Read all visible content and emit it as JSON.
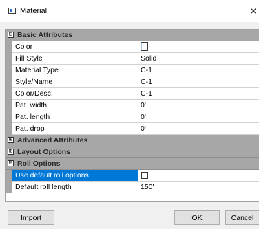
{
  "window": {
    "title": "Material",
    "close_glyph": "✕"
  },
  "grid": {
    "categories": [
      {
        "label": "Basic Attributes",
        "expanded": true,
        "expander": "⊟",
        "properties": [
          {
            "name": "Color",
            "value": "",
            "kind": "color-swatch"
          },
          {
            "name": "Fill Style",
            "value": "Solid"
          },
          {
            "name": "Material Type",
            "value": "C-1"
          },
          {
            "name": "Style/Name",
            "value": "C-1"
          },
          {
            "name": "Color/Desc.",
            "value": "C-1"
          },
          {
            "name": "Pat. width",
            "value": "0'"
          },
          {
            "name": "Pat. length",
            "value": "0'"
          },
          {
            "name": "Pat. drop",
            "value": "0'"
          }
        ]
      },
      {
        "label": "Advanced Attributes",
        "expanded": false,
        "expander": "⊞"
      },
      {
        "label": "Layout Options",
        "expanded": false,
        "expander": "⊞"
      },
      {
        "label": "Roll Options",
        "expanded": true,
        "expander": "⊟",
        "properties": [
          {
            "name": "Use default roll options",
            "value": "",
            "kind": "checkbox",
            "checked": false,
            "selected": true
          },
          {
            "name": "Default roll length",
            "value": "150'"
          }
        ]
      }
    ]
  },
  "buttons": {
    "import": "Import",
    "ok": "OK",
    "cancel": "Cancel"
  },
  "colors": {
    "selection": "#0078d7",
    "category_bg": "#a7a7a7",
    "dialog_bg": "#f0f0f0"
  }
}
